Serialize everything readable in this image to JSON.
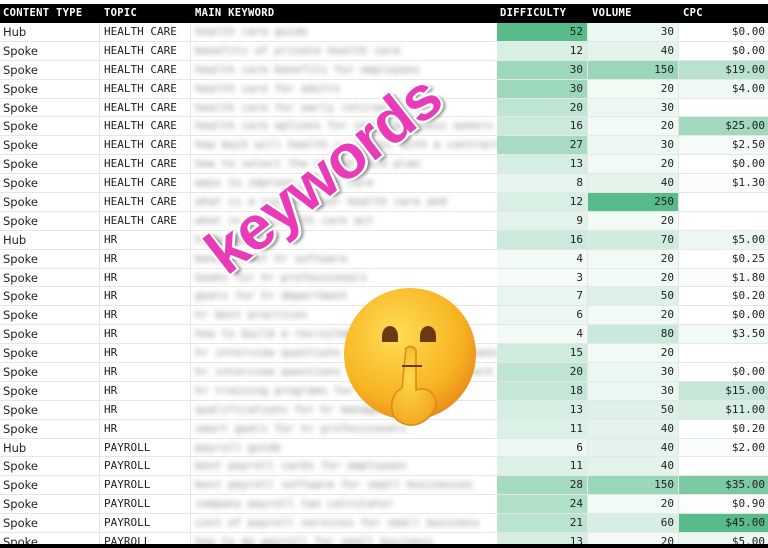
{
  "columns": {
    "content_type": "CONTENT TYPE",
    "topic": "TOPIC",
    "main_keyword": "MAIN KEYWORD",
    "difficulty": "DIFFICULTY",
    "volume": "VOLUME",
    "cpc": "CPC"
  },
  "overlay": {
    "text": "keywords",
    "text_color": "#e93bb7",
    "emoji": "shushing-face"
  },
  "heat_color": "#57bb8a",
  "rows": [
    {
      "type": "Hub",
      "topic": "HEALTH CARE",
      "keyword": "health care guide",
      "difficulty": 52,
      "volume": 30,
      "cpc": "$0.00"
    },
    {
      "type": "Spoke",
      "topic": "HEALTH CARE",
      "keyword": "benefits of private health care",
      "difficulty": 12,
      "volume": 40,
      "cpc": "$0.00"
    },
    {
      "type": "Spoke",
      "topic": "HEALTH CARE",
      "keyword": "health care benefits for employees",
      "difficulty": 30,
      "volume": 150,
      "cpc": "$19.00"
    },
    {
      "type": "Spoke",
      "topic": "HEALTH CARE",
      "keyword": "health care for adults",
      "difficulty": 30,
      "volume": 20,
      "cpc": "$4.00"
    },
    {
      "type": "Spoke",
      "topic": "HEALTH CARE",
      "keyword": "health care for early retirees",
      "difficulty": 20,
      "volume": 30,
      "cpc": ""
    },
    {
      "type": "Spoke",
      "topic": "HEALTH CARE",
      "keyword": "health care options for small business owners",
      "difficulty": 16,
      "volume": 20,
      "cpc": "$25.00"
    },
    {
      "type": "Spoke",
      "topic": "HEALTH CARE",
      "keyword": "how much will health care cost with a contract",
      "difficulty": 27,
      "volume": 30,
      "cpc": "$2.50"
    },
    {
      "type": "Spoke",
      "topic": "HEALTH CARE",
      "keyword": "how to select the health care plan",
      "difficulty": 13,
      "volume": 20,
      "cpc": "$0.00"
    },
    {
      "type": "Spoke",
      "topic": "HEALTH CARE",
      "keyword": "ways to improve health care",
      "difficulty": 8,
      "volume": 40,
      "cpc": "$1.30"
    },
    {
      "type": "Spoke",
      "topic": "HEALTH CARE",
      "keyword": "what is a single payer health care and",
      "difficulty": 12,
      "volume": 250,
      "cpc": ""
    },
    {
      "type": "Spoke",
      "topic": "HEALTH CARE",
      "keyword": "what is the health care act",
      "difficulty": 9,
      "volume": 20,
      "cpc": ""
    },
    {
      "type": "Hub",
      "topic": "HR",
      "keyword": "hr guide",
      "difficulty": 16,
      "volume": 70,
      "cpc": "$5.00"
    },
    {
      "type": "Spoke",
      "topic": "HR",
      "keyword": "benefits of hr software",
      "difficulty": 4,
      "volume": 20,
      "cpc": "$0.25"
    },
    {
      "type": "Spoke",
      "topic": "HR",
      "keyword": "books for hr professionals",
      "difficulty": 3,
      "volume": 20,
      "cpc": "$1.80"
    },
    {
      "type": "Spoke",
      "topic": "HR",
      "keyword": "goals for hr department",
      "difficulty": 7,
      "volume": 50,
      "cpc": "$0.20"
    },
    {
      "type": "Spoke",
      "topic": "HR",
      "keyword": "hr best practices",
      "difficulty": 6,
      "volume": 20,
      "cpc": "$0.00"
    },
    {
      "type": "Spoke",
      "topic": "HR",
      "keyword": "how to build a recruitment",
      "difficulty": 4,
      "volume": 80,
      "cpc": "$3.50"
    },
    {
      "type": "Spoke",
      "topic": "HR",
      "keyword": "hr interview questions for small business owner",
      "difficulty": 15,
      "volume": 20,
      "cpc": ""
    },
    {
      "type": "Spoke",
      "topic": "HR",
      "keyword": "hr interview questions for employees and tech",
      "difficulty": 20,
      "volume": 30,
      "cpc": "$0.00"
    },
    {
      "type": "Spoke",
      "topic": "HR",
      "keyword": "hr training programs for managers",
      "difficulty": 18,
      "volume": 30,
      "cpc": "$15.00"
    },
    {
      "type": "Spoke",
      "topic": "HR",
      "keyword": "qualifications for hr manager",
      "difficulty": 13,
      "volume": 50,
      "cpc": "$11.00"
    },
    {
      "type": "Spoke",
      "topic": "HR",
      "keyword": "smart goals for hr professionals",
      "difficulty": 11,
      "volume": 40,
      "cpc": "$0.20"
    },
    {
      "type": "Hub",
      "topic": "PAYROLL",
      "keyword": "payroll guide",
      "difficulty": 6,
      "volume": 40,
      "cpc": "$2.00"
    },
    {
      "type": "Spoke",
      "topic": "PAYROLL",
      "keyword": "best payroll cards for employees",
      "difficulty": 11,
      "volume": 40,
      "cpc": ""
    },
    {
      "type": "Spoke",
      "topic": "PAYROLL",
      "keyword": "best payroll software for small businesses",
      "difficulty": 28,
      "volume": 150,
      "cpc": "$35.00"
    },
    {
      "type": "Spoke",
      "topic": "PAYROLL",
      "keyword": "company payroll tax calculator",
      "difficulty": 24,
      "volume": 20,
      "cpc": "$0.90"
    },
    {
      "type": "Spoke",
      "topic": "PAYROLL",
      "keyword": "cost of payroll services for small business",
      "difficulty": 21,
      "volume": 60,
      "cpc": "$45.00"
    },
    {
      "type": "Spoke",
      "topic": "PAYROLL",
      "keyword": "how to do payroll for small business",
      "difficulty": 13,
      "volume": 20,
      "cpc": "$5.00"
    }
  ]
}
